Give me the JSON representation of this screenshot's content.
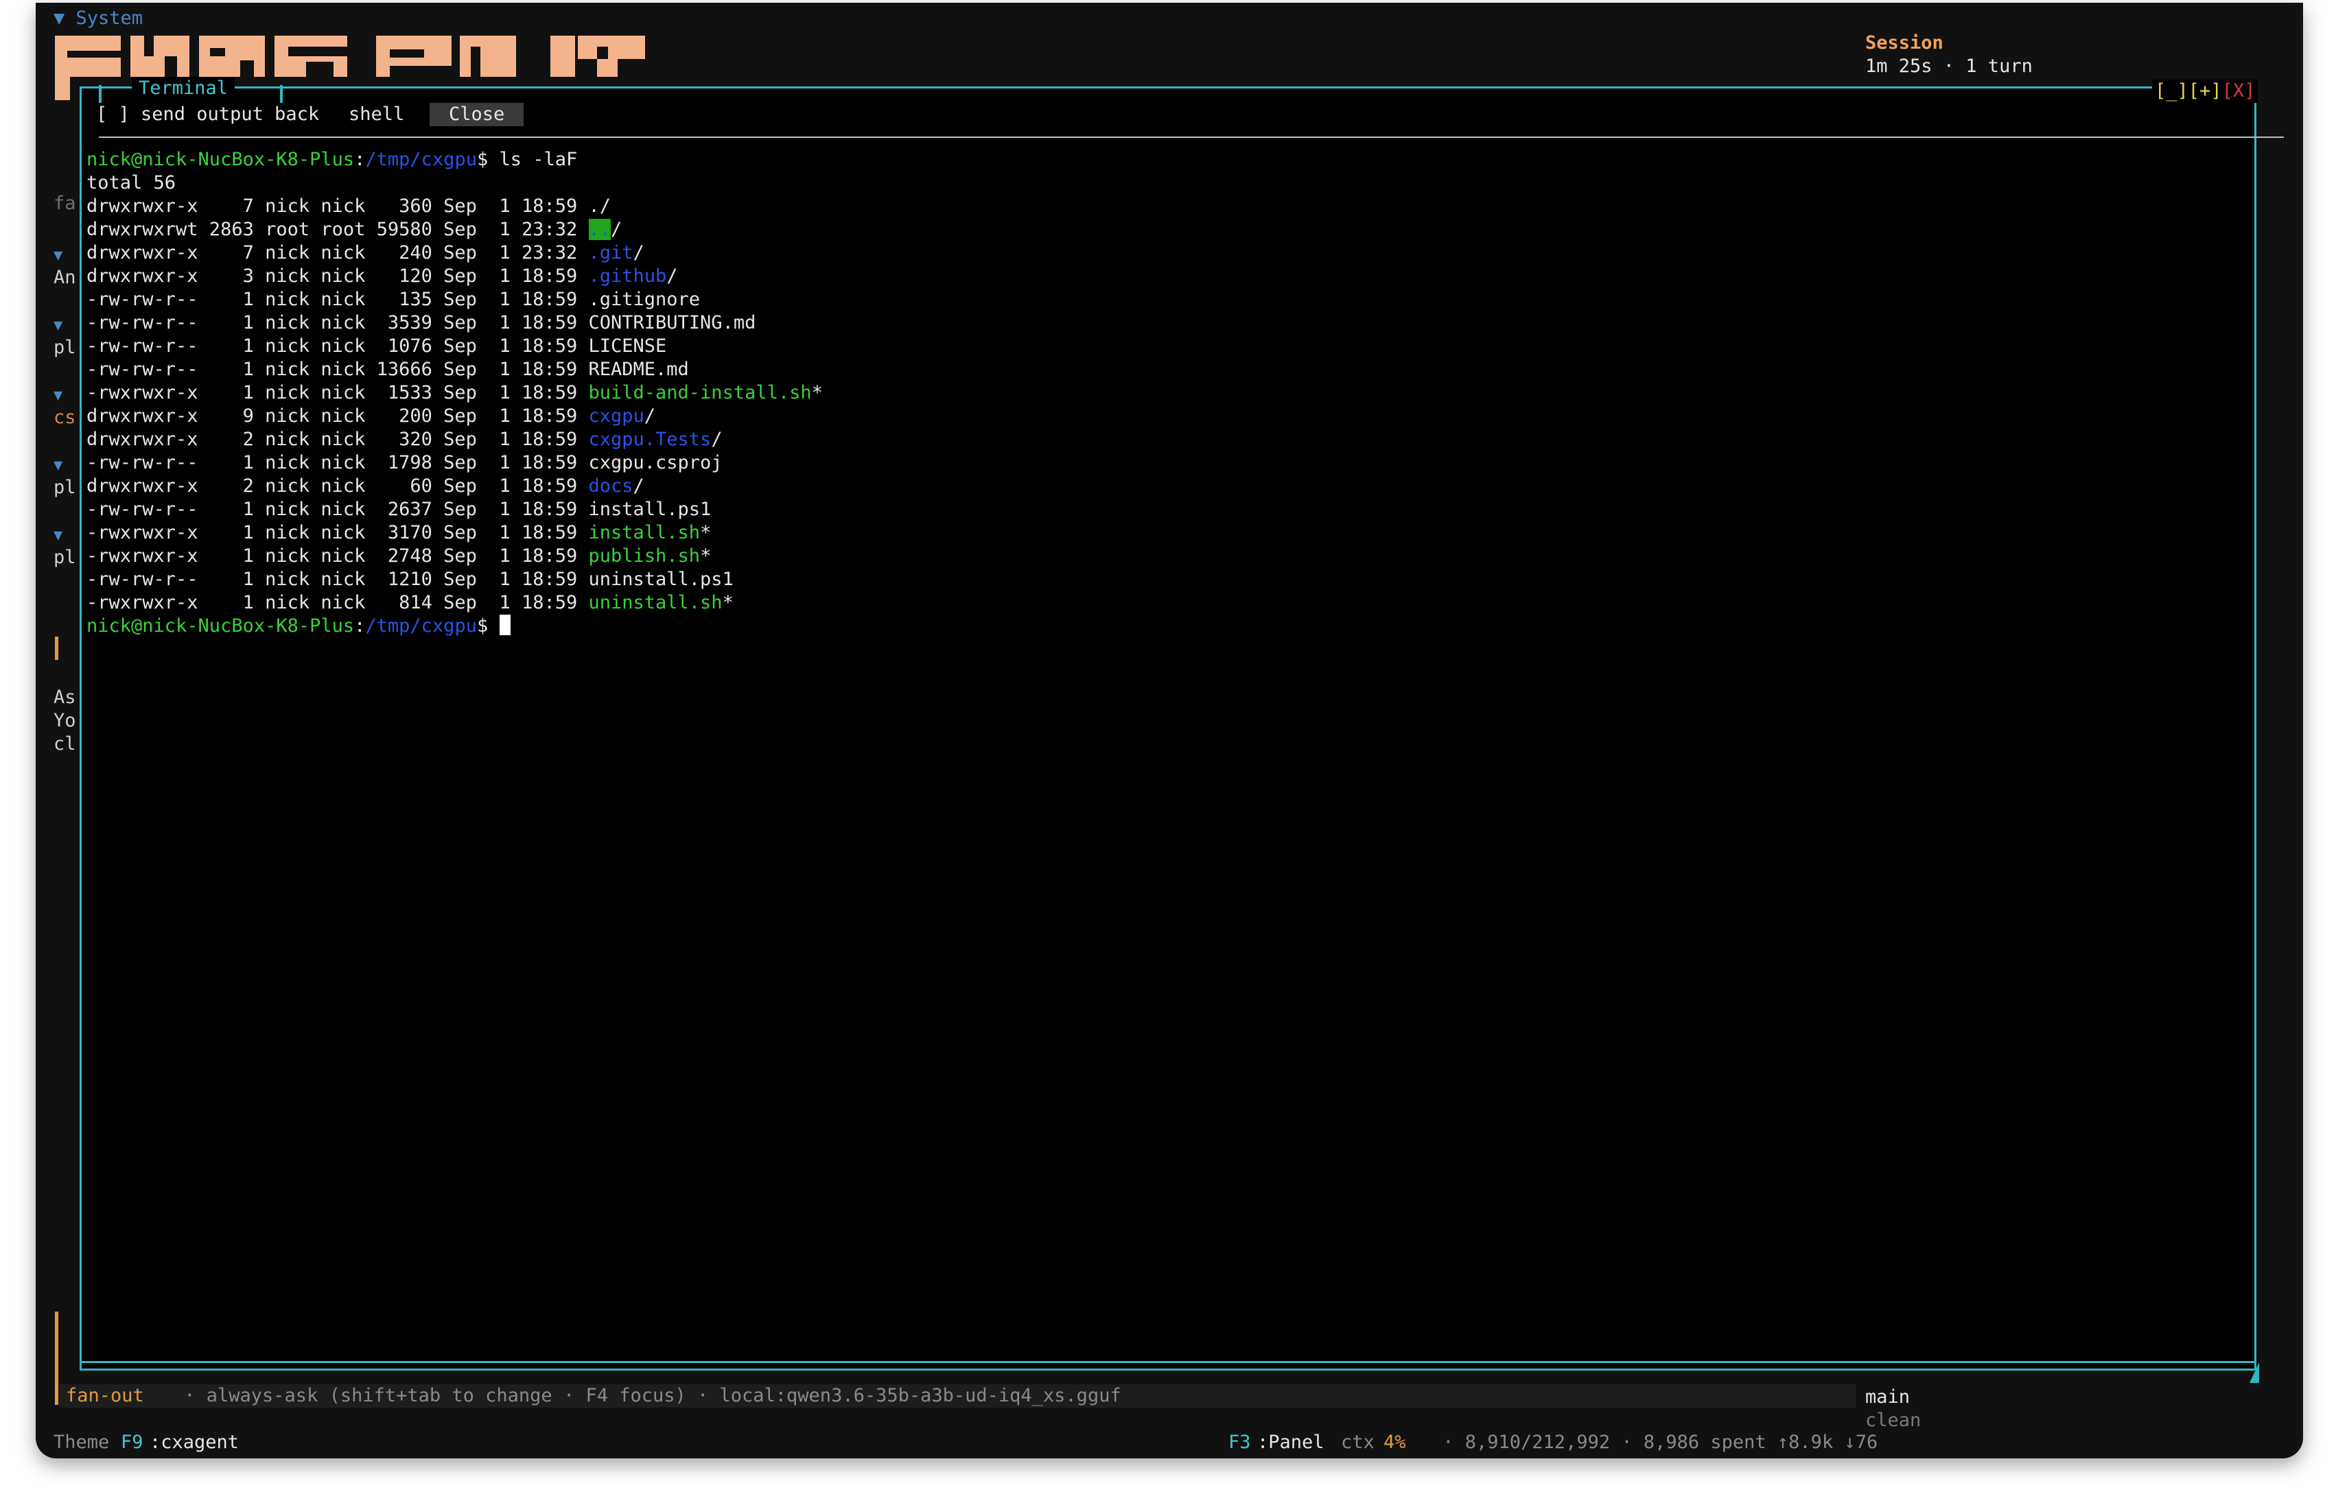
{
  "header": {
    "system_label": "▼ System",
    "session_title": "Session",
    "session_info": "1m 25s · 1 turn"
  },
  "left_strip": {
    "items": [
      {
        "glyph": "fa",
        "style": "dim"
      },
      {
        "glyph": "▼",
        "style": "tri"
      },
      {
        "glyph": "An",
        "style": "text"
      },
      {
        "glyph": "▼",
        "style": "tri"
      },
      {
        "glyph": "pl",
        "style": "text"
      },
      {
        "glyph": "▼",
        "style": "tri"
      },
      {
        "glyph": "cs",
        "style": "orange"
      },
      {
        "glyph": "▼",
        "style": "tri"
      },
      {
        "glyph": "pl",
        "style": "text"
      },
      {
        "glyph": "▼",
        "style": "tri"
      },
      {
        "glyph": "pl",
        "style": "text"
      },
      {
        "glyph": "As",
        "style": "text"
      },
      {
        "glyph": "Yo",
        "style": "text"
      },
      {
        "glyph": "cl",
        "style": "text"
      }
    ]
  },
  "terminal": {
    "title": "Terminal",
    "window_controls": {
      "minimize": "[_]",
      "maximize": "[+]",
      "close": "[X]"
    },
    "toolbar": {
      "send_output_back": "[ ] send output back",
      "shell": "shell",
      "close": "Close"
    },
    "prompt": {
      "user_host": "nick@nick-NucBox-K8-Plus",
      "colon": ":",
      "path": "/tmp/cxgpu",
      "dollar": "$"
    },
    "command": " ls -laF",
    "total": "total 56",
    "listing": [
      {
        "meta": "drwxrwxr-x    7 nick nick   360 Sep  1 18:59 ",
        "name": ".",
        "suffix": "/",
        "color": "w"
      },
      {
        "meta": "drwxrwxrwt 2863 root root 59580 Sep  1 23:32 ",
        "name": "..",
        "suffix": "/",
        "color": "hl"
      },
      {
        "meta": "drwxrwxr-x    7 nick nick   240 Sep  1 23:32 ",
        "name": ".git",
        "suffix": "/",
        "color": "b"
      },
      {
        "meta": "drwxrwxr-x    3 nick nick   120 Sep  1 18:59 ",
        "name": ".github",
        "suffix": "/",
        "color": "b"
      },
      {
        "meta": "-rw-rw-r--    1 nick nick   135 Sep  1 18:59 ",
        "name": ".gitignore",
        "suffix": "",
        "color": "w"
      },
      {
        "meta": "-rw-rw-r--    1 nick nick  3539 Sep  1 18:59 ",
        "name": "CONTRIBUTING.md",
        "suffix": "",
        "color": "w"
      },
      {
        "meta": "-rw-rw-r--    1 nick nick  1076 Sep  1 18:59 ",
        "name": "LICENSE",
        "suffix": "",
        "color": "w"
      },
      {
        "meta": "-rw-rw-r--    1 nick nick 13666 Sep  1 18:59 ",
        "name": "README.md",
        "suffix": "",
        "color": "w"
      },
      {
        "meta": "-rwxrwxr-x    1 nick nick  1533 Sep  1 18:59 ",
        "name": "build-and-install.sh",
        "suffix": "*",
        "color": "g"
      },
      {
        "meta": "drwxrwxr-x    9 nick nick   200 Sep  1 18:59 ",
        "name": "cxgpu",
        "suffix": "/",
        "color": "b"
      },
      {
        "meta": "drwxrwxr-x    2 nick nick   320 Sep  1 18:59 ",
        "name": "cxgpu.Tests",
        "suffix": "/",
        "color": "b"
      },
      {
        "meta": "-rw-rw-r--    1 nick nick  1798 Sep  1 18:59 ",
        "name": "cxgpu.csproj",
        "suffix": "",
        "color": "w"
      },
      {
        "meta": "drwxrwxr-x    2 nick nick    60 Sep  1 18:59 ",
        "name": "docs",
        "suffix": "/",
        "color": "b"
      },
      {
        "meta": "-rw-rw-r--    1 nick nick  2637 Sep  1 18:59 ",
        "name": "install.ps1",
        "suffix": "",
        "color": "w"
      },
      {
        "meta": "-rwxrwxr-x    1 nick nick  3170 Sep  1 18:59 ",
        "name": "install.sh",
        "suffix": "*",
        "color": "g"
      },
      {
        "meta": "-rwxrwxr-x    1 nick nick  2748 Sep  1 18:59 ",
        "name": "publish.sh",
        "suffix": "*",
        "color": "g"
      },
      {
        "meta": "-rw-rw-r--    1 nick nick  1210 Sep  1 18:59 ",
        "name": "uninstall.ps1",
        "suffix": "",
        "color": "w"
      },
      {
        "meta": "-rwxrwxr-x    1 nick nick   814 Sep  1 18:59 ",
        "name": "uninstall.sh",
        "suffix": "*",
        "color": "g"
      }
    ]
  },
  "status": {
    "mode": "fan-out",
    "mode_rest": " · always-ask (shift+tab to change · F4 focus) · local:qwen3.6-35b-a3b-ud-iq4_xs.gguf",
    "branch": "main",
    "branch_state": "clean",
    "theme_label": "Theme",
    "theme_key": "F9",
    "theme_name": ":cxagent",
    "panel_key": "F3",
    "panel_label": ":Panel",
    "ctx_label": "ctx",
    "ctx_pct": "4%",
    "ctx_rest": " · 8,910/212,992 · 8,986 spent ↑8.9k ↓76"
  },
  "colors": {
    "accent_cyan": "#2fb8c2",
    "accent_orange": "#e39a45",
    "logo_peach": "#f3b48d",
    "term_green": "#39d23a",
    "term_blue": "#2b52e6"
  }
}
